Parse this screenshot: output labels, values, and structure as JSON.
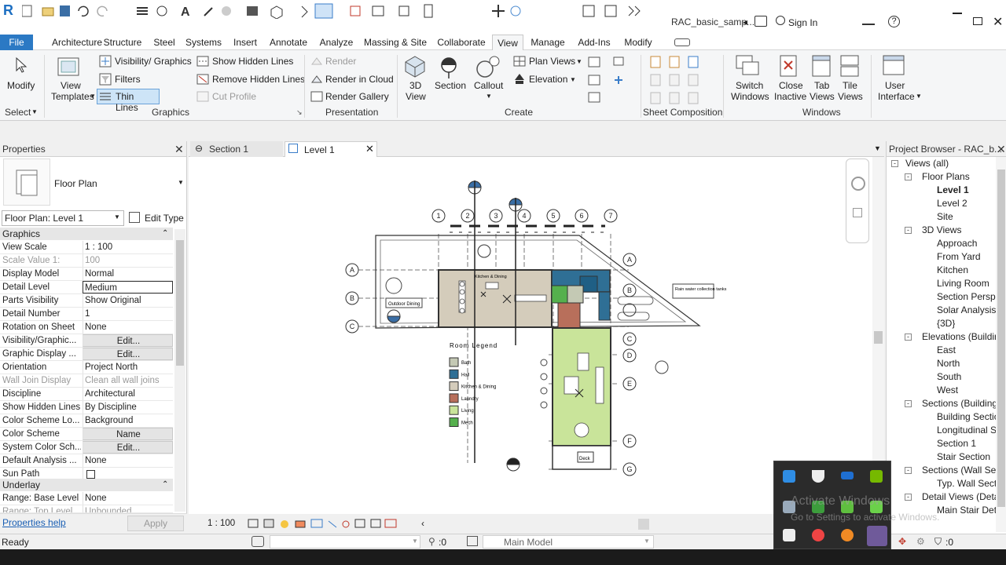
{
  "titlebar": {
    "doc_title": "RAC_basic_samp...",
    "sign_in": "Sign In",
    "help": "?"
  },
  "menu": {
    "items": [
      "File",
      "Architecture",
      "Structure",
      "Steel",
      "Systems",
      "Insert",
      "Annotate",
      "Analyze",
      "Massing & Site",
      "Collaborate",
      "View",
      "Manage",
      "Add-Ins",
      "Modify"
    ],
    "active": "View"
  },
  "ribbon": {
    "modify": "Modify",
    "select": "Select",
    "view_templates": [
      "View",
      "Templates"
    ],
    "visibility_graphics": "Visibility/ Graphics",
    "filters": "Filters",
    "thin_lines": "Thin  Lines",
    "show_hidden_lines": "Show  Hidden Lines",
    "remove_hidden_lines": "Remove  Hidden Lines",
    "cut_profile": "Cut  Profile",
    "graphics_title": "Graphics",
    "render": "Render",
    "render_in_cloud": "Render  in Cloud",
    "render_gallery": "Render  Gallery",
    "presentation_title": "Presentation",
    "view_3d": [
      "3D",
      "View"
    ],
    "section": "Section",
    "callout": "Callout",
    "plan_views": "Plan  Views",
    "elevation": "Elevation",
    "create_title": "Create",
    "sheet_composition_title": "Sheet Composition",
    "switch_windows": [
      "Switch",
      "Windows"
    ],
    "close_inactive": [
      "Close",
      "Inactive"
    ],
    "tab_views": [
      "Tab",
      "Views"
    ],
    "tile_views": [
      "Tile",
      "Views"
    ],
    "windows_title": "Windows",
    "user_interface": [
      "User",
      "Interface"
    ]
  },
  "properties": {
    "title": "Properties",
    "type_name": "Floor Plan",
    "instance": "Floor Plan: Level 1",
    "edit_type": "Edit Type",
    "sections": {
      "graphics": "Graphics",
      "underlay": "Underlay"
    },
    "rows": [
      {
        "k": "View Scale",
        "v": "1 : 100",
        "dis": false
      },
      {
        "k": "Scale Value    1:",
        "v": "100",
        "dis": true
      },
      {
        "k": "Display Model",
        "v": "Normal",
        "dis": false
      },
      {
        "k": "Detail Level",
        "v": "Medium",
        "dis": false
      },
      {
        "k": "Parts Visibility",
        "v": "Show Original",
        "dis": false
      },
      {
        "k": "Detail Number",
        "v": "1",
        "dis": false
      },
      {
        "k": "Rotation on Sheet",
        "v": "None",
        "dis": false
      },
      {
        "k": "Visibility/Graphic...",
        "v": "Edit...",
        "dis": false
      },
      {
        "k": "Graphic Display ...",
        "v": "Edit...",
        "dis": false
      },
      {
        "k": "Orientation",
        "v": "Project North",
        "dis": false
      },
      {
        "k": "Wall Join Display",
        "v": "Clean all wall joins",
        "dis": true
      },
      {
        "k": "Discipline",
        "v": "Architectural",
        "dis": false
      },
      {
        "k": "Show Hidden Lines",
        "v": "By Discipline",
        "dis": false
      },
      {
        "k": "Color Scheme Lo...",
        "v": "Background",
        "dis": false
      },
      {
        "k": "Color Scheme",
        "v": "Name",
        "dis": false
      },
      {
        "k": "System Color Sch...",
        "v": "Edit...",
        "dis": false
      },
      {
        "k": "Default Analysis ...",
        "v": "None",
        "dis": false
      },
      {
        "k": "Sun Path",
        "v": "",
        "dis": false
      }
    ],
    "underlay_rows": [
      {
        "k": "Range: Base Level",
        "v": "None",
        "dis": false
      },
      {
        "k": "Range: Top Level",
        "v": "Unbounded",
        "dis": true
      }
    ],
    "help": "Properties help",
    "apply": "Apply"
  },
  "tabs": [
    {
      "label": "Section 1",
      "active": false
    },
    {
      "label": "Level 1",
      "active": true
    }
  ],
  "drawing": {
    "grid_top": [
      "1",
      "2",
      "3",
      "4",
      "5",
      "6",
      "7"
    ],
    "grid_right": [
      "A",
      "B",
      "C",
      "D",
      "E",
      "F",
      "G"
    ],
    "grid_left": [
      "A",
      "B",
      "C"
    ],
    "room_legend_title": "Room  Legend",
    "legend": [
      {
        "label": "Bath",
        "color": "#c4c9b4"
      },
      {
        "label": "Hall",
        "color": "#2f6f95"
      },
      {
        "label": "Kitchen & Dining",
        "color": "#d4ccbb"
      },
      {
        "label": "Laundry",
        "color": "#b86f5b"
      },
      {
        "label": "Living",
        "color": "#c9e49a"
      },
      {
        "label": "Mech",
        "color": "#55b04d"
      }
    ],
    "outdoor_dining": "Outdoor Dining",
    "rain_water": "Rain water collection tanks",
    "deck": "Deck",
    "kitchen_tag": "Kitchen & Dining"
  },
  "viewbar": {
    "scale": "1 : 100"
  },
  "browser": {
    "title": "Project Browser - RAC_b...",
    "items": [
      {
        "label": "Views (all)",
        "level": 0,
        "box": "-"
      },
      {
        "label": "Floor Plans",
        "level": 1,
        "box": "-"
      },
      {
        "label": "Level 1",
        "level": 2,
        "bold": true
      },
      {
        "label": "Level 2",
        "level": 2
      },
      {
        "label": "Site",
        "level": 2
      },
      {
        "label": "3D Views",
        "level": 1,
        "box": "-"
      },
      {
        "label": "Approach",
        "level": 2
      },
      {
        "label": "From Yard",
        "level": 2
      },
      {
        "label": "Kitchen",
        "level": 2
      },
      {
        "label": "Living Room",
        "level": 2
      },
      {
        "label": "Section Perspe",
        "level": 2
      },
      {
        "label": "Solar Analysis",
        "level": 2
      },
      {
        "label": "{3D}",
        "level": 2
      },
      {
        "label": "Elevations (Building",
        "level": 1,
        "box": "-"
      },
      {
        "label": "East",
        "level": 2
      },
      {
        "label": "North",
        "level": 2
      },
      {
        "label": "South",
        "level": 2
      },
      {
        "label": "West",
        "level": 2
      },
      {
        "label": "Sections (Building",
        "level": 1,
        "box": "-"
      },
      {
        "label": "Building Sectio",
        "level": 2
      },
      {
        "label": "Longitudinal Se",
        "level": 2
      },
      {
        "label": "Section 1",
        "level": 2
      },
      {
        "label": "Stair Section",
        "level": 2
      },
      {
        "label": "Sections (Wall Sect",
        "level": 1,
        "box": "-"
      },
      {
        "label": "Typ. Wall Sectic",
        "level": 2
      },
      {
        "label": "Detail Views (Detail",
        "level": 1,
        "box": "-"
      },
      {
        "label": "Main Stair Deta",
        "level": 2
      }
    ]
  },
  "status": {
    "ready": "Ready",
    "zero1": ":0",
    "main_model": "Main Model",
    "zero2": ":0"
  },
  "overlay": {
    "activate": "Activate Windows",
    "goto": "Go to Settings to activate Windows."
  }
}
